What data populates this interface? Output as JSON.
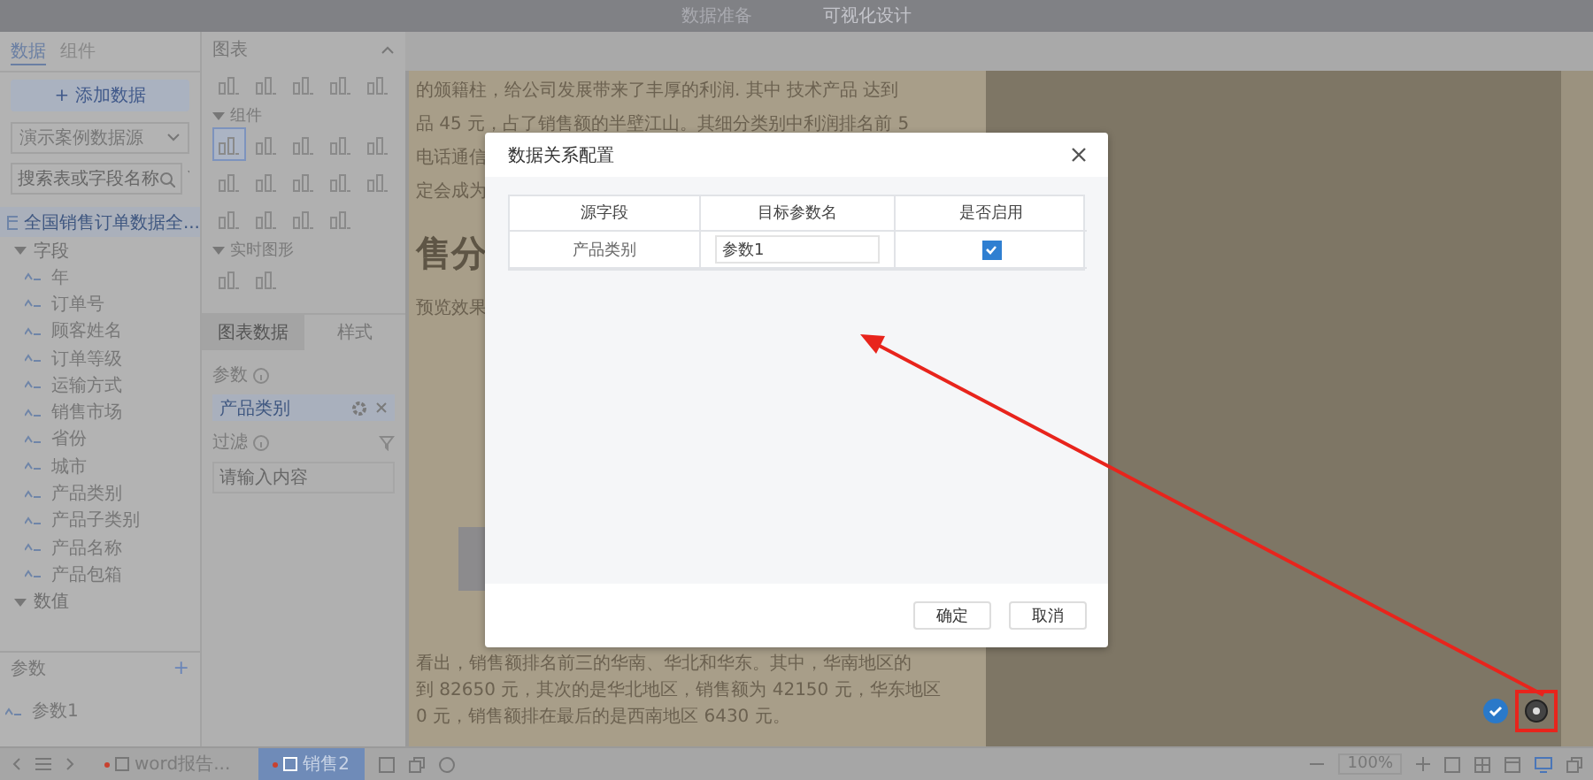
{
  "top_bar": {
    "tabs": [
      {
        "label": "数据准备",
        "selected": false
      },
      {
        "label": "可视化设计",
        "selected": true
      }
    ]
  },
  "data_panel": {
    "tabs": [
      {
        "label": "数据",
        "selected": true
      },
      {
        "label": "组件",
        "selected": false
      }
    ],
    "add_button": "+ 添加数据",
    "source_select": "演示案例数据源",
    "search": {
      "placeholder": "搜索表或字段名称"
    },
    "table_name": "全国销售订单数据全...",
    "groups": [
      {
        "label": "字段",
        "expanded": true,
        "children": [
          {
            "label": "年"
          },
          {
            "label": "订单号"
          },
          {
            "label": "顾客姓名"
          },
          {
            "label": "订单等级"
          },
          {
            "label": "运输方式"
          },
          {
            "label": "销售市场"
          },
          {
            "label": "省份"
          },
          {
            "label": "城市"
          },
          {
            "label": "产品类别"
          },
          {
            "label": "产品子类别"
          },
          {
            "label": "产品名称"
          },
          {
            "label": "产品包箱"
          }
        ]
      },
      {
        "label": "数值",
        "expanded": true
      }
    ]
  },
  "params_panel": {
    "title": "参数",
    "add": "+",
    "items": [
      {
        "label": "参数1"
      }
    ]
  },
  "chart_panel": {
    "title": "图表",
    "sections": [
      {
        "items": [
          {
            "selected": false
          },
          {
            "selected": false
          },
          {
            "selected": false
          },
          {
            "selected": false
          },
          {
            "selected": false
          }
        ]
      },
      {
        "label": "组件",
        "expanded": true,
        "items": [
          {
            "selected": true
          },
          {
            "selected": false
          },
          {
            "selected": false
          },
          {
            "selected": false
          },
          {
            "selected": false
          },
          {
            "selected": false
          },
          {
            "selected": false
          },
          {
            "selected": false
          },
          {
            "selected": false
          },
          {
            "selected": false
          },
          {
            "selected": false
          },
          {
            "selected": false
          },
          {
            "selected": false
          },
          {
            "selected": false
          }
        ]
      },
      {
        "label": "实时图形",
        "expanded": true,
        "items": [
          {
            "selected": false
          },
          {
            "selected": false
          }
        ]
      }
    ],
    "tabs": [
      {
        "label": "图表数据",
        "selected": true
      },
      {
        "label": "样式",
        "selected": false
      }
    ],
    "param_label": "参数",
    "param_chip": "产品类别",
    "filter_label": "过滤",
    "filter": {
      "placeholder": "请输入内容"
    }
  },
  "document": {
    "lines_top": [
      "的颁籍柱，给公司发展带来了丰厚的利润. 其中 技术产品 达到",
      "品 45 元，占了销售额的半壁江山。其细分类别中利润排名前 5",
      "电话通信",
      "定会成为"
    ],
    "heading": "售分",
    "caption": "预览效果",
    "lines_bottom": [
      "看出，销售额排名前三的华南、华北和华东。其中，华南地区的",
      "到 82650 元，其次的是华北地区，销售额为 42150 元，华东地区",
      "0 元，销售额排在最后的是西南地区 6430 元。"
    ]
  },
  "bottom_bar": {
    "sheets": [
      {
        "label": "word报告...",
        "selected": false,
        "modified": true
      },
      {
        "label": "销售2",
        "selected": true,
        "modified": true
      }
    ],
    "zoom": "100%"
  },
  "dialog": {
    "title": "数据关系配置",
    "columns": [
      "源字段",
      "目标参数名",
      "是否启用"
    ],
    "rows": [
      {
        "source": "产品类别",
        "target": "参数1",
        "enabled": true
      }
    ],
    "buttons": [
      "确定",
      "取消"
    ]
  }
}
